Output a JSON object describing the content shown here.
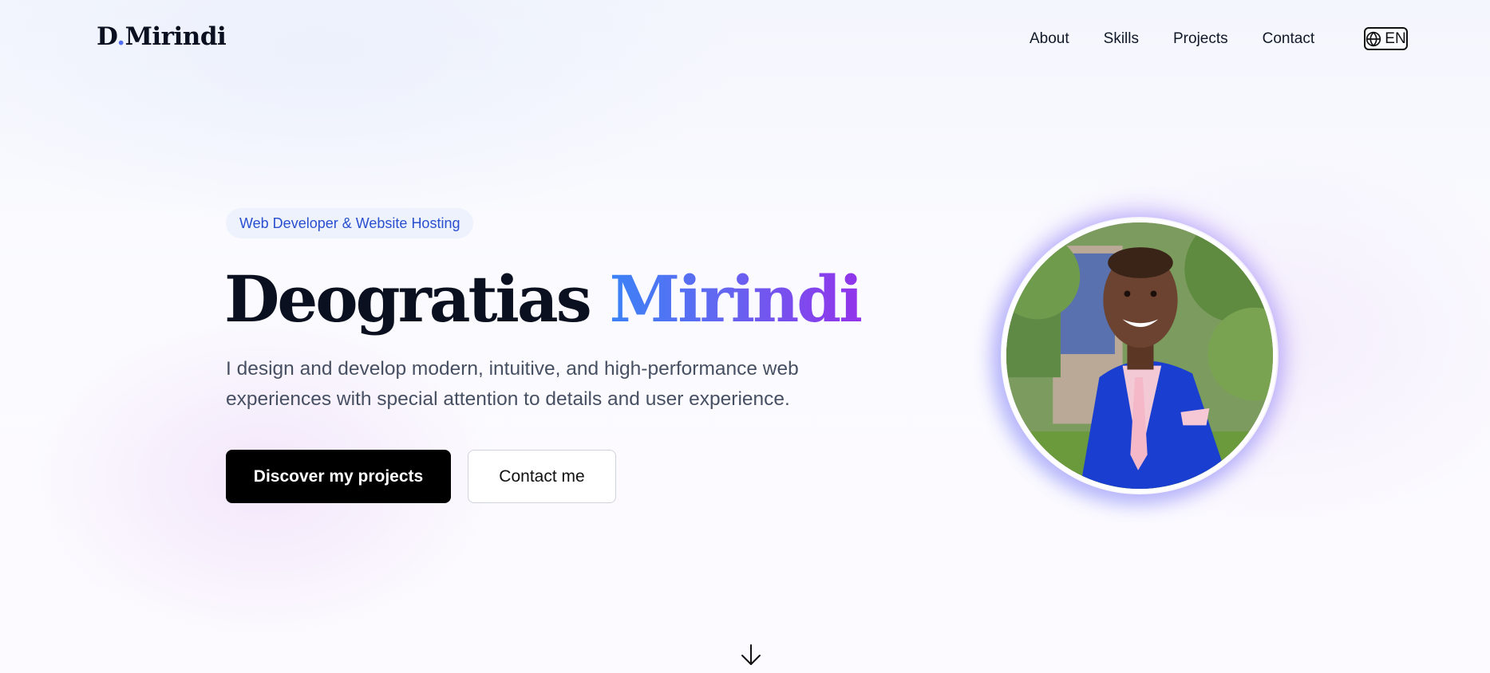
{
  "header": {
    "logo_main": "D",
    "logo_dot": ".",
    "logo_rest": "Mirindi",
    "nav": [
      "About",
      "Skills",
      "Projects",
      "Contact"
    ],
    "language": "EN"
  },
  "hero": {
    "badge": "Web Developer & Website Hosting",
    "first_name": "Deogratias",
    "last_name": "Mirindi",
    "description": "I design and develop modern, intuitive, and high-performance web experiences with special attention to details and user experience.",
    "primary_button": "Discover my projects",
    "secondary_button": "Contact me"
  },
  "icons": {
    "language": "globe-icon",
    "scroll": "arrow-down-icon"
  },
  "colors": {
    "accent_blue": "#3b82f6",
    "accent_purple": "#9333ea",
    "badge_text": "#2a4fcf"
  }
}
